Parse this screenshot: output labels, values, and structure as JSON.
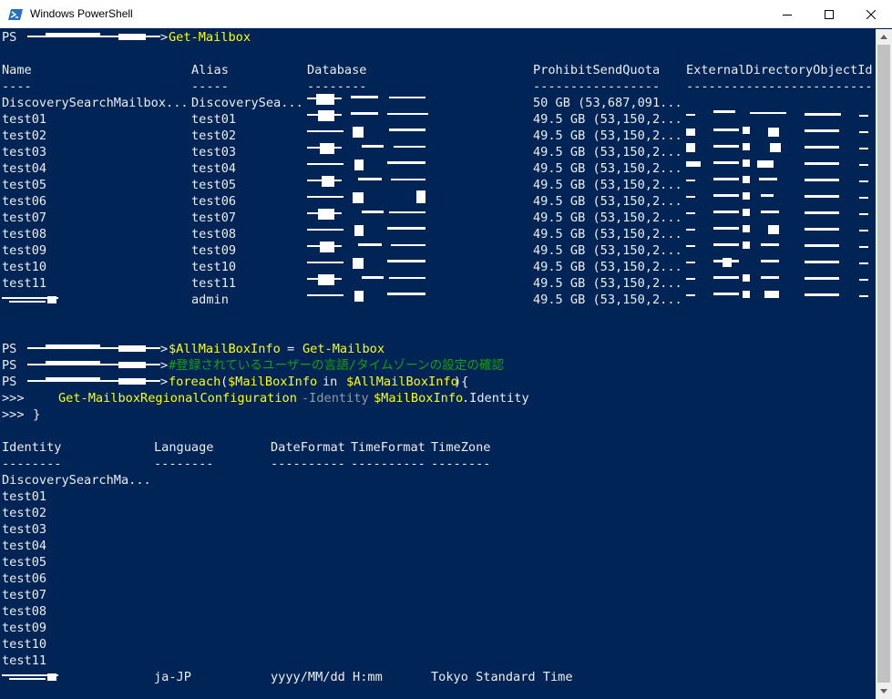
{
  "window": {
    "title": "Windows PowerShell",
    "icon": "powershell-icon",
    "controls": [
      "minimize-icon",
      "maximize-icon",
      "close-icon"
    ]
  },
  "colors": {
    "console_bg": "#012456",
    "text": "#eeedf0",
    "command": "#ffff00",
    "comment": "#13a10e",
    "parameter": "#999999"
  },
  "prompt": {
    "ps": "PS",
    "arrow": ">",
    "continuation": ">>>"
  },
  "cmd1": {
    "command": "Get-Mailbox"
  },
  "mailbox_table": {
    "headers": [
      "Name",
      "Alias",
      "Database",
      "ProhibitSendQuota",
      "ExternalDirectoryObjectId"
    ],
    "underlines": [
      "----",
      "-----",
      "--------",
      "-----------------",
      "-------------------------"
    ],
    "rows": [
      [
        "DiscoverySearchMailbox...",
        "DiscoverySea...",
        "",
        "50 GB (53,687,091..."
      ],
      [
        "test01",
        "test01",
        "",
        "49.5 GB (53,150,2..."
      ],
      [
        "test02",
        "test02",
        "",
        "49.5 GB (53,150,2..."
      ],
      [
        "test03",
        "test03",
        "",
        "49.5 GB (53,150,2..."
      ],
      [
        "test04",
        "test04",
        "",
        "49.5 GB (53,150,2..."
      ],
      [
        "test05",
        "test05",
        "",
        "49.5 GB (53,150,2..."
      ],
      [
        "test06",
        "test06",
        "",
        "49.5 GB (53,150,2..."
      ],
      [
        "test07",
        "test07",
        "",
        "49.5 GB (53,150,2..."
      ],
      [
        "test08",
        "test08",
        "",
        "49.5 GB (53,150,2..."
      ],
      [
        "test09",
        "test09",
        "",
        "49.5 GB (53,150,2..."
      ],
      [
        "test10",
        "test10",
        "",
        "49.5 GB (53,150,2..."
      ],
      [
        "test11",
        "test11",
        "",
        "49.5 GB (53,150,2..."
      ],
      [
        "",
        "admin",
        "",
        "49.5 GB (53,150,2..."
      ]
    ]
  },
  "cmd2": {
    "variable": "$AllMailBoxInfo",
    "operator": "=",
    "command": "Get-Mailbox"
  },
  "cmd3": {
    "comment": "#登録されているユーザーの言語/タイムゾーンの設定の確認"
  },
  "cmd4": {
    "keyword": "foreach",
    "open": "(",
    "var": "$MailBoxInfo",
    "in": "in",
    "collection": "$AllMailBoxInfo",
    "close": "){"
  },
  "cmd5": {
    "indent": "     ",
    "command": "Get-MailboxRegionalConfiguration",
    "param": "-Identity",
    "var": "$MailBoxInfo",
    "member": ".Identity"
  },
  "cmd6": {
    "text": " }"
  },
  "regional_table": {
    "headers": [
      "Identity",
      "Language",
      "DateFormat",
      "TimeFormat",
      "TimeZone"
    ],
    "underlines": [
      "--------",
      "--------",
      "----------",
      "----------",
      "--------"
    ],
    "rows": [
      [
        "DiscoverySearchMa..."
      ],
      [
        "test01"
      ],
      [
        "test02"
      ],
      [
        "test03"
      ],
      [
        "test04"
      ],
      [
        "test05"
      ],
      [
        "test06"
      ],
      [
        "test07"
      ],
      [
        "test08"
      ],
      [
        "test09"
      ],
      [
        "test10"
      ],
      [
        "test11"
      ],
      [
        "",
        "ja-JP",
        "yyyy/MM/dd H:mm",
        "",
        "Tokyo Standard Time"
      ]
    ]
  }
}
